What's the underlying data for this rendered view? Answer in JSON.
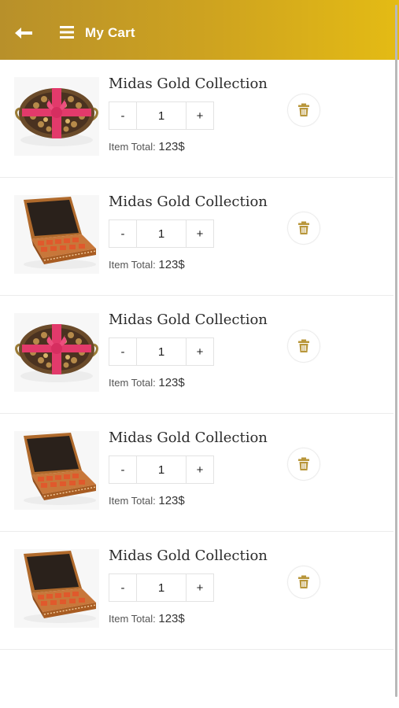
{
  "header": {
    "title": "My Cart",
    "back_icon": "arrow-left-icon",
    "menu_icon": "hamburger-menu-icon"
  },
  "colors": {
    "header_start": "#b8902a",
    "header_end": "#e4bb14",
    "trash_icon": "#b8963a"
  },
  "items": [
    {
      "name": "Midas Gold Collection",
      "qty": "1",
      "minus": "-",
      "plus": "+",
      "total_label": "Item Total:",
      "total_value": "123$",
      "image": "round-chocolate-tray-with-ribbon"
    },
    {
      "name": "Midas Gold Collection",
      "qty": "1",
      "minus": "-",
      "plus": "+",
      "total_label": "Item Total:",
      "total_value": "123$",
      "image": "wooden-chocolate-box"
    },
    {
      "name": "Midas Gold Collection",
      "qty": "1",
      "minus": "-",
      "plus": "+",
      "total_label": "Item Total:",
      "total_value": "123$",
      "image": "round-chocolate-tray-with-ribbon"
    },
    {
      "name": "Midas Gold Collection",
      "qty": "1",
      "minus": "-",
      "plus": "+",
      "total_label": "Item Total:",
      "total_value": "123$",
      "image": "wooden-chocolate-box"
    },
    {
      "name": "Midas Gold Collection",
      "qty": "1",
      "minus": "-",
      "plus": "+",
      "total_label": "Item Total:",
      "total_value": "123$",
      "image": "wooden-chocolate-box"
    }
  ]
}
